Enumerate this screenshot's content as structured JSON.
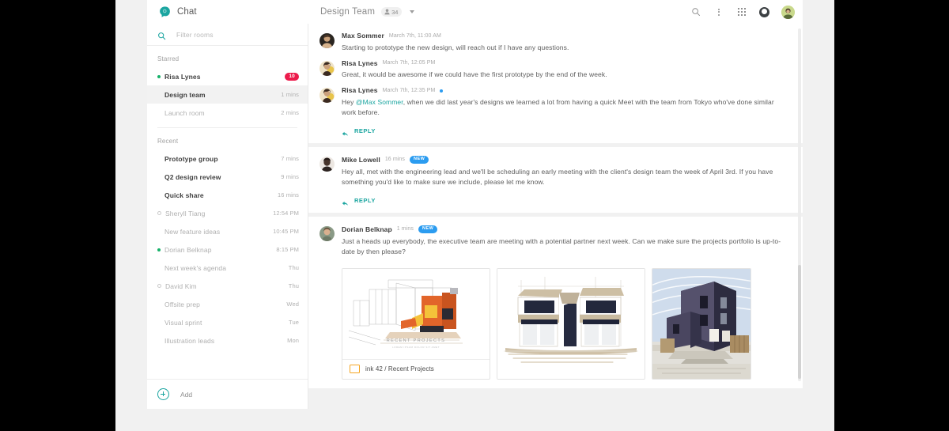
{
  "brand": {
    "name": "Chat",
    "logo_icon": "chat-bubble-icon",
    "accent": "#1aa5a0"
  },
  "header": {
    "room_title": "Design Team",
    "member_icon": "person-icon",
    "member_count": "34",
    "dropdown_icon": "chevron-down-icon",
    "icons": [
      "search-icon",
      "more-vert-icon",
      "apps-grid-icon",
      "account-circle-icon",
      "avatar"
    ]
  },
  "sidebar": {
    "filter": {
      "icon": "search-icon",
      "placeholder": "Filter rooms",
      "value": ""
    },
    "sections": [
      {
        "label": "Starred",
        "items": [
          {
            "name": "Risa Lynes",
            "meta": "",
            "badge": "10",
            "status": "online",
            "bold": true,
            "muted": false
          },
          {
            "name": "Design team",
            "meta": "1 mins",
            "badge": "",
            "status": "none",
            "bold": true,
            "muted": false,
            "selected": true
          },
          {
            "name": "Launch room",
            "meta": "2 mins",
            "badge": "",
            "status": "none",
            "bold": false,
            "muted": true
          }
        ]
      },
      {
        "label": "Recent",
        "items": [
          {
            "name": "Prototype group",
            "meta": "7 mins",
            "badge": "",
            "status": "none",
            "bold": true,
            "muted": false
          },
          {
            "name": "Q2 design review",
            "meta": "9 mins",
            "badge": "",
            "status": "none",
            "bold": true,
            "muted": false
          },
          {
            "name": "Quick share",
            "meta": "16 mins",
            "badge": "",
            "status": "none",
            "bold": true,
            "muted": false
          },
          {
            "name": "Sheryll Tiang",
            "meta": "12:54 PM",
            "badge": "",
            "status": "away",
            "bold": false,
            "muted": true
          },
          {
            "name": "New feature ideas",
            "meta": "10:45 PM",
            "badge": "",
            "status": "none",
            "bold": false,
            "muted": true
          },
          {
            "name": "Dorian Belknap",
            "meta": "8:15 PM",
            "badge": "",
            "status": "online",
            "bold": false,
            "muted": true
          },
          {
            "name": "Next week's agenda",
            "meta": "Thu",
            "badge": "",
            "status": "none",
            "bold": false,
            "muted": true
          },
          {
            "name": "David Kim",
            "meta": "Thu",
            "badge": "",
            "status": "away",
            "bold": false,
            "muted": true
          },
          {
            "name": "Offsite prep",
            "meta": "Wed",
            "badge": "",
            "status": "none",
            "bold": false,
            "muted": true
          },
          {
            "name": "Visual sprint",
            "meta": "Tue",
            "badge": "",
            "status": "none",
            "bold": false,
            "muted": true
          },
          {
            "name": "Illustration leads",
            "meta": "Mon",
            "badge": "",
            "status": "none",
            "bold": false,
            "muted": true
          }
        ]
      }
    ],
    "add": {
      "icon": "add-circle-icon",
      "label": "Add"
    },
    "badge_color": "#ec1b4b",
    "online_color": "#17b26a"
  },
  "conversation": {
    "reply_label": "REPLY",
    "reply_icon": "reply-arrow-icon",
    "new_badge": "NEW",
    "groups": [
      {
        "messages": [
          {
            "author": "Max Sommer",
            "time": "March 7th, 11:00 AM",
            "unread_dot": false,
            "new": false,
            "text": "Starting to prototype the new design, will reach out if I have any questions."
          },
          {
            "author": "Risa Lynes",
            "time": "March 7th, 12:05 PM",
            "unread_dot": false,
            "new": false,
            "text": "Great, it would be awesome if we could have the first prototype by the end of the week."
          },
          {
            "author": "Risa Lynes",
            "time": "March 7th, 12:35 PM",
            "unread_dot": true,
            "new": false,
            "text_before": "Hey ",
            "mention": "@Max Sommer",
            "text_after": ", when we did last year's designs we learned a lot from having a quick Meet with the team from Tokyo who've done similar work before."
          }
        ],
        "has_reply": true
      },
      {
        "messages": [
          {
            "author": "Mike Lowell",
            "time": "16 mins",
            "unread_dot": false,
            "new": true,
            "text": "Hey all, met with the engineering lead and we'll be scheduling an early meeting with the client's design team the week of April 3rd. If you have something you'd like to make sure we include, please let me know."
          }
        ],
        "has_reply": true
      },
      {
        "messages": [
          {
            "author": "Dorian Belknap",
            "time": "1 mins",
            "unread_dot": false,
            "new": true,
            "text": "Just a heads up everybody, the executive team are meeting with a potential partner next week. Can we make sure the projects portfolio is up-to-date by then please?"
          }
        ],
        "has_reply": false,
        "attachments": [
          {
            "type": "slides-document",
            "icon": "slides-icon",
            "label": "ink 42 / Recent Projects",
            "preview_title": "RECENT PROJECTS",
            "preview_subtitle": "LOREM IPSUM DOLOR SIT AMET"
          },
          {
            "type": "image",
            "alt": "architectural-rendering-duplex"
          },
          {
            "type": "image",
            "alt": "architectural-rendering-dark-house"
          }
        ]
      }
    ]
  }
}
